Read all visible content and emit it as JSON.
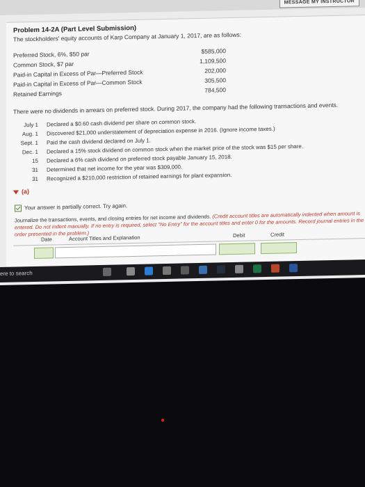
{
  "header": {
    "message_button": "MESSAGE MY INSTRUCTOR"
  },
  "problem": {
    "title": "Problem 14-2A (Part Level Submission)",
    "intro": "The stockholders' equity accounts of Karp Company at January 1, 2017, are as follows:",
    "equity": [
      {
        "label": "Preferred Stock, 6%, $50 par",
        "value": "$585,000"
      },
      {
        "label": "Common Stock, $7 par",
        "value": "1,109,500"
      },
      {
        "label": "Paid-in Capital in Excess of Par—Preferred Stock",
        "value": "202,000"
      },
      {
        "label": "Paid-in Capital in Excess of Par—Common Stock",
        "value": "305,500"
      },
      {
        "label": "Retained Earnings",
        "value": "784,500"
      }
    ],
    "paragraph": "There were no dividends in arrears on preferred stock. During 2017, the company had the following transactions and events.",
    "transactions": [
      {
        "date": "July 1",
        "desc": "Declared a $0.60 cash dividend per share on common stock."
      },
      {
        "date": "Aug. 1",
        "desc": "Discovered $21,000 understatement of depreciation expense in 2016. (Ignore income taxes.)"
      },
      {
        "date": "Sept. 1",
        "desc": "Paid the cash dividend declared on July 1."
      },
      {
        "date": "Dec. 1",
        "desc": "Declared a 15% stock dividend on common stock when the market price of the stock was $15 per share."
      },
      {
        "date": "15",
        "desc": "Declared a 6% cash dividend on preferred stock payable January 15, 2018."
      },
      {
        "date": "31",
        "desc": "Determined that net income for the year was $309,000."
      },
      {
        "date": "31",
        "desc": "Recognized a $210,000 restriction of retained earnings for plant expansion."
      }
    ]
  },
  "part_a": {
    "label": "(a)",
    "status": "Your answer is partially correct.  Try again.",
    "instruction_plain": "Journalize the transactions, events, and closing entries for net income and dividends.",
    "instruction_red": "(Credit account titles are automatically indented when amount is entered. Do not indent manually. If no entry is required, select \"No Entry\" for the account titles and enter 0 for the amounts. Record journal entries in the order presented in the problem.)",
    "columns": {
      "date": "Date",
      "account": "Account Titles and Explanation",
      "debit": "Debit",
      "credit": "Credit"
    }
  },
  "taskbar": {
    "search_text": "ere to search"
  }
}
